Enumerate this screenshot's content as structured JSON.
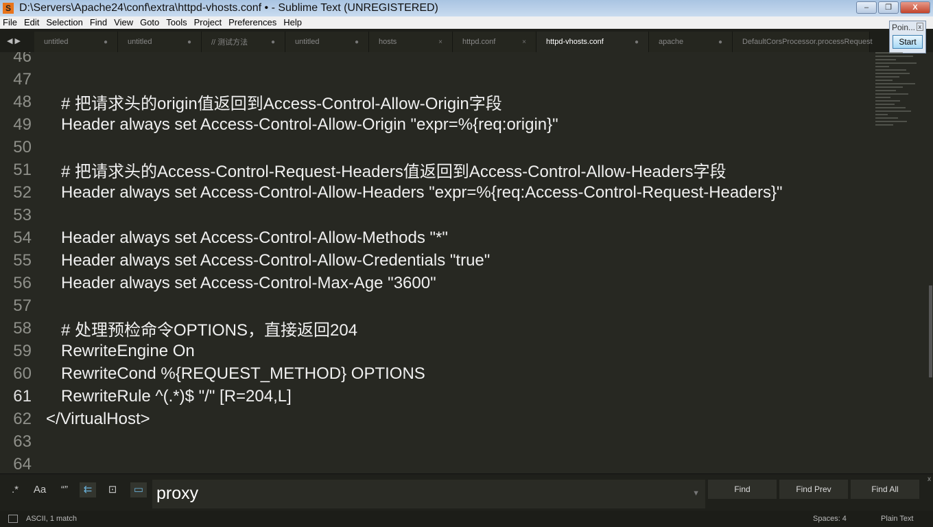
{
  "window": {
    "title": "D:\\Servers\\Apache24\\conf\\extra\\httpd-vhosts.conf • - Sublime Text (UNREGISTERED)",
    "minimize": "–",
    "restore": "❐",
    "close": "X"
  },
  "menu": [
    "File",
    "Edit",
    "Selection",
    "Find",
    "View",
    "Goto",
    "Tools",
    "Project",
    "Preferences",
    "Help"
  ],
  "tabs": [
    {
      "label": "untitled",
      "mark": "●"
    },
    {
      "label": "untitled",
      "mark": "●"
    },
    {
      "label": "// 测试方法",
      "mark": "●"
    },
    {
      "label": "untitled",
      "mark": "●"
    },
    {
      "label": "hosts",
      "mark": "×"
    },
    {
      "label": "httpd.conf",
      "mark": "×"
    },
    {
      "label": "httpd-vhosts.conf",
      "mark": "●",
      "active": true
    },
    {
      "label": "apache",
      "mark": "●"
    },
    {
      "label": "DefaultCorsProcessor.processRequest",
      "mark": ""
    }
  ],
  "popup": {
    "title": "Poin...",
    "close": "x",
    "start": "Start"
  },
  "editor": {
    "current_line": 61,
    "lines": [
      {
        "n": "46",
        "text": "",
        "indent": 1
      },
      {
        "n": "47",
        "text": "",
        "indent": 1
      },
      {
        "n": "48",
        "text": "# 把请求头的origin值返回到Access-Control-Allow-Origin字段",
        "indent": 1
      },
      {
        "n": "49",
        "text": "Header always set Access-Control-Allow-Origin \"expr=%{req:origin}\"",
        "indent": 1
      },
      {
        "n": "50",
        "text": "",
        "indent": 1
      },
      {
        "n": "51",
        "text": "# 把请求头的Access-Control-Request-Headers值返回到Access-Control-Allow-Headers字段",
        "indent": 1
      },
      {
        "n": "52",
        "text": "Header always set Access-Control-Allow-Headers \"expr=%{req:Access-Control-Request-Headers}\"",
        "indent": 1
      },
      {
        "n": "53",
        "text": "",
        "indent": 1
      },
      {
        "n": "54",
        "text": "Header always set Access-Control-Allow-Methods \"*\"",
        "indent": 1
      },
      {
        "n": "55",
        "text": "Header always set Access-Control-Allow-Credentials \"true\"",
        "indent": 1
      },
      {
        "n": "56",
        "text": "Header always set Access-Control-Max-Age \"3600\"",
        "indent": 1
      },
      {
        "n": "57",
        "text": "",
        "indent": 1
      },
      {
        "n": "58",
        "text": "# 处理预检命令OPTIONS，直接返回204",
        "indent": 1
      },
      {
        "n": "59",
        "text": "RewriteEngine On",
        "indent": 1
      },
      {
        "n": "60",
        "text": "RewriteCond %{REQUEST_METHOD} OPTIONS",
        "indent": 1
      },
      {
        "n": "61",
        "text": "RewriteRule ^(.*)$ \"/\" [R=204,L]",
        "indent": 1
      },
      {
        "n": "62",
        "text": "</VirtualHost>",
        "indent": 0
      },
      {
        "n": "63",
        "text": "",
        "indent": 0
      },
      {
        "n": "64",
        "text": "",
        "indent": 0
      }
    ]
  },
  "find": {
    "options": [
      ".*",
      "Aa",
      "“”",
      "⇇",
      "⊡",
      "▭"
    ],
    "value": "proxy",
    "find": "Find",
    "find_prev": "Find Prev",
    "find_all": "Find All",
    "close": "x"
  },
  "status": {
    "left": "ASCII, 1 match",
    "spaces": "Spaces: 4",
    "syntax": "Plain Text"
  }
}
